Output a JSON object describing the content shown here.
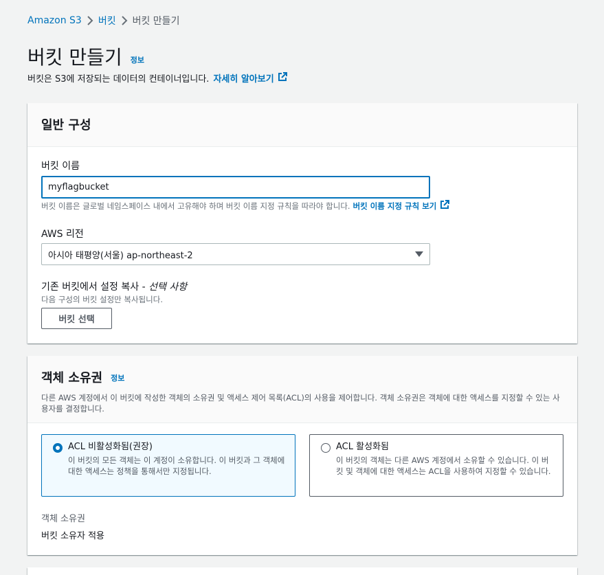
{
  "breadcrumb": {
    "items": [
      "Amazon S3",
      "버킷",
      "버킷 만들기"
    ]
  },
  "header": {
    "title": "버킷 만들기",
    "info": "정보",
    "description": "버킷은 S3에 저장되는 데이터의 컨테이너입니다.",
    "learn_more": "자세히 알아보기"
  },
  "general": {
    "title": "일반 구성",
    "bucket_name_label": "버킷 이름",
    "bucket_name_value": "myflagbucket",
    "bucket_name_hint": "버킷 이름은 글로벌 네임스페이스 내에서 고유해야 하며 버킷 이름 지정 규칙을 따라야 합니다.",
    "naming_rules_link": "버킷 이름 지정 규칙 보기",
    "region_label": "AWS 리전",
    "region_value": "아시아 태평양(서울) ap-northeast-2",
    "copy_label": "기존 버킷에서 설정 복사 - ",
    "copy_optional": "선택 사항",
    "copy_hint": "다음 구성의 버킷 설정만 복사됩니다.",
    "choose_bucket_button": "버킷 선택"
  },
  "ownership": {
    "title": "객체 소유권",
    "info": "정보",
    "description": "다른 AWS 계정에서 이 버킷에 작성한 객체의 소유권 및 액세스 제어 목록(ACL)의 사용을 제어합니다. 객체 소유권은 객체에 대한 액세스를 지정할 수 있는 사용자를 결정합니다.",
    "options": [
      {
        "title": "ACL 비활성화됨(권장)",
        "description": "이 버킷의 모든 객체는 이 계정이 소유합니다. 이 버킷과 그 객체에 대한 액세스는 정책을 통해서만 지정됩니다.",
        "selected": true
      },
      {
        "title": "ACL 활성화됨",
        "description": "이 버킷의 객체는 다른 AWS 계정에서 소유할 수 있습니다. 이 버킷 및 객체에 대한 액세스는 ACL을 사용하여 지정할 수 있습니다.",
        "selected": false
      }
    ],
    "ownership_label": "객체 소유권",
    "ownership_value": "버킷 소유자 적용"
  },
  "colors": {
    "link": "#0073bb",
    "background": "#f2f3f3",
    "selected_card": "#f1faff"
  }
}
